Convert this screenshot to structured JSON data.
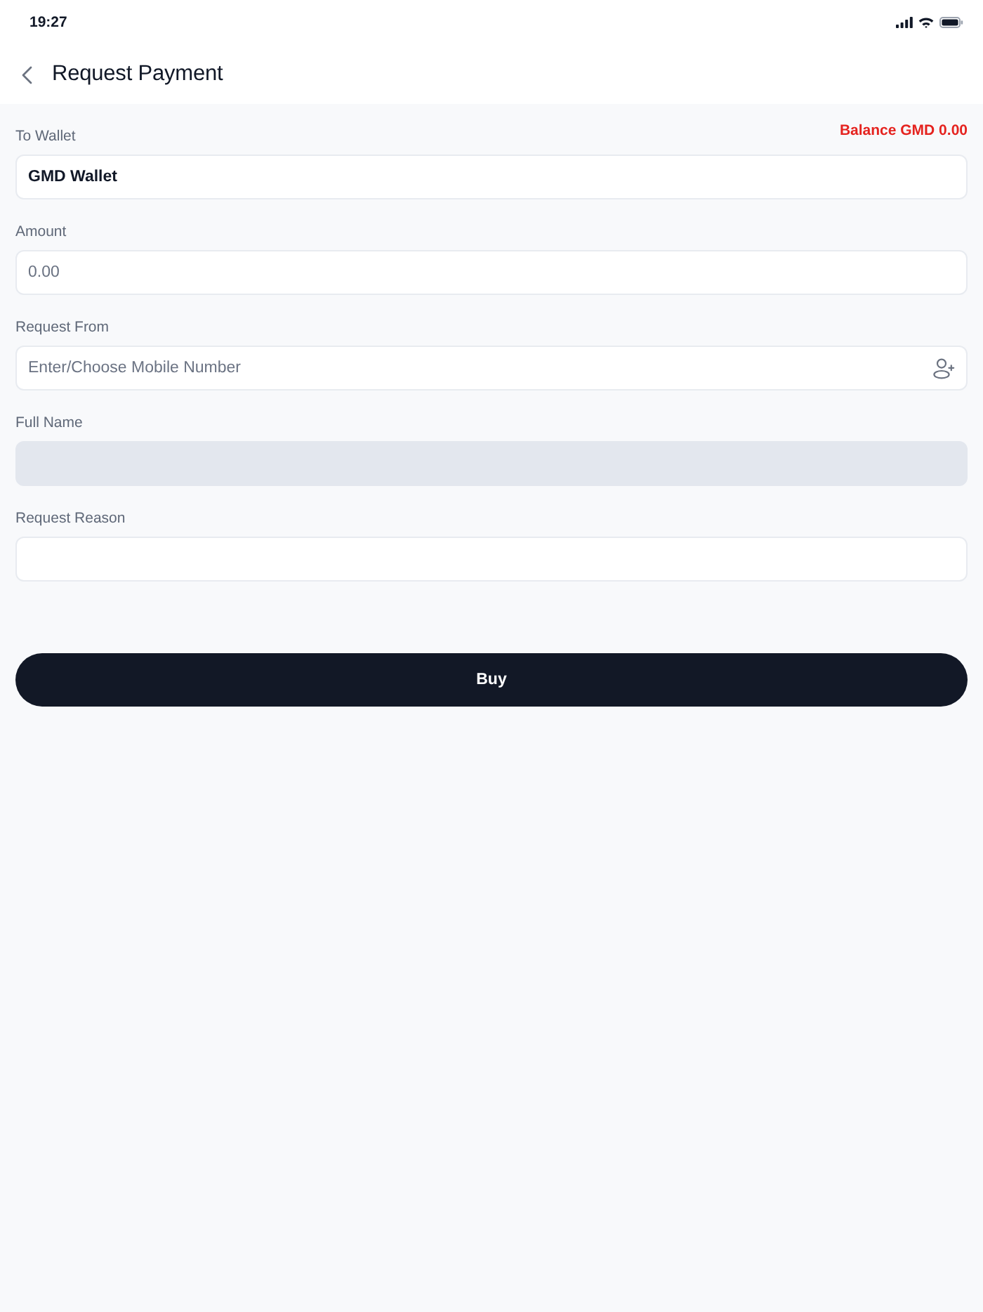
{
  "status_bar": {
    "time": "19:27"
  },
  "header": {
    "title": "Request Payment"
  },
  "fields": [
    {
      "kind": "select",
      "label": "To Wallet",
      "note": "Balance GMD 0.00",
      "value": "GMD Wallet",
      "disabled": false
    },
    {
      "kind": "input",
      "label": "Amount",
      "placeholder": "0.00",
      "disabled": false
    },
    {
      "kind": "contact",
      "label": "Request From",
      "placeholder": "Enter/Choose Mobile Number",
      "disabled": false
    },
    {
      "kind": "input",
      "label": "Full Name",
      "disabled": true
    },
    {
      "kind": "input",
      "label": "Request Reason",
      "disabled": false
    }
  ],
  "submit": {
    "label": "Buy"
  }
}
